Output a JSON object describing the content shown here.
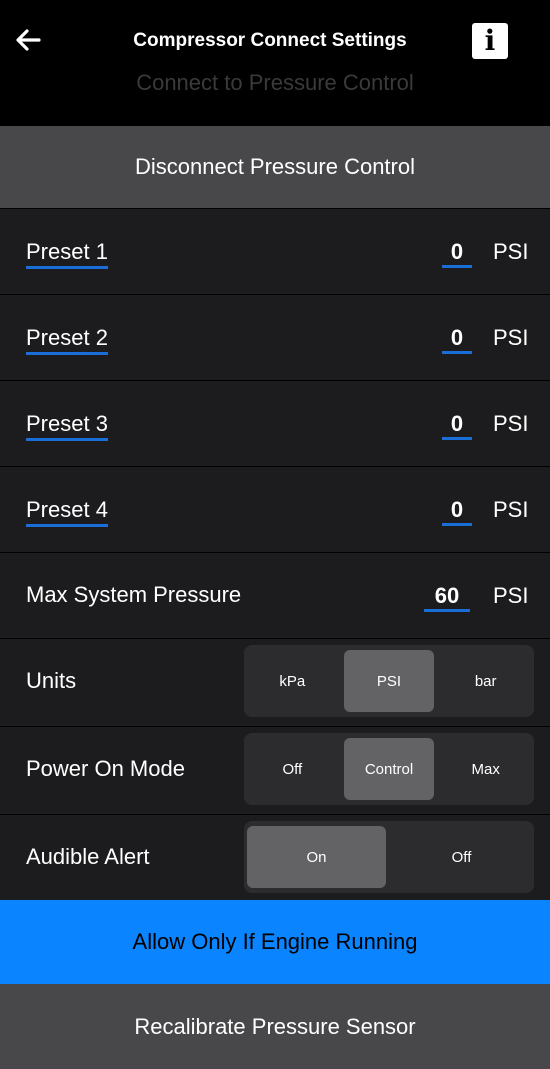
{
  "header": {
    "back_icon": "arrow-left-icon",
    "title": "Compressor Connect Settings",
    "subtitle": "Connect to Pressure Control",
    "info_icon": "info-icon",
    "info_glyph": "i"
  },
  "disconnect_label": "Disconnect Pressure Control",
  "presets": [
    {
      "label": "Preset 1",
      "value": "0",
      "unit": "PSI"
    },
    {
      "label": "Preset 2",
      "value": "0",
      "unit": "PSI"
    },
    {
      "label": "Preset 3",
      "value": "0",
      "unit": "PSI"
    },
    {
      "label": "Preset 4",
      "value": "0",
      "unit": "PSI"
    }
  ],
  "max_pressure": {
    "label": "Max System Pressure",
    "value": "60",
    "unit": "PSI"
  },
  "units": {
    "label": "Units",
    "options": [
      "kPa",
      "PSI",
      "bar"
    ],
    "selected": "PSI"
  },
  "power_on_mode": {
    "label": "Power On Mode",
    "options": [
      "Off",
      "Control",
      "Max"
    ],
    "selected": "Control"
  },
  "audible_alert": {
    "label": "Audible Alert",
    "options": [
      "On",
      "Off"
    ],
    "selected": "On"
  },
  "engine_running_label": "Allow Only If Engine Running",
  "recalibrate_label": "Recalibrate Pressure Sensor",
  "colors": {
    "accent_blue": "#0a84ff",
    "underline_blue": "#1a6ed8",
    "selected_segment": "#636366"
  }
}
